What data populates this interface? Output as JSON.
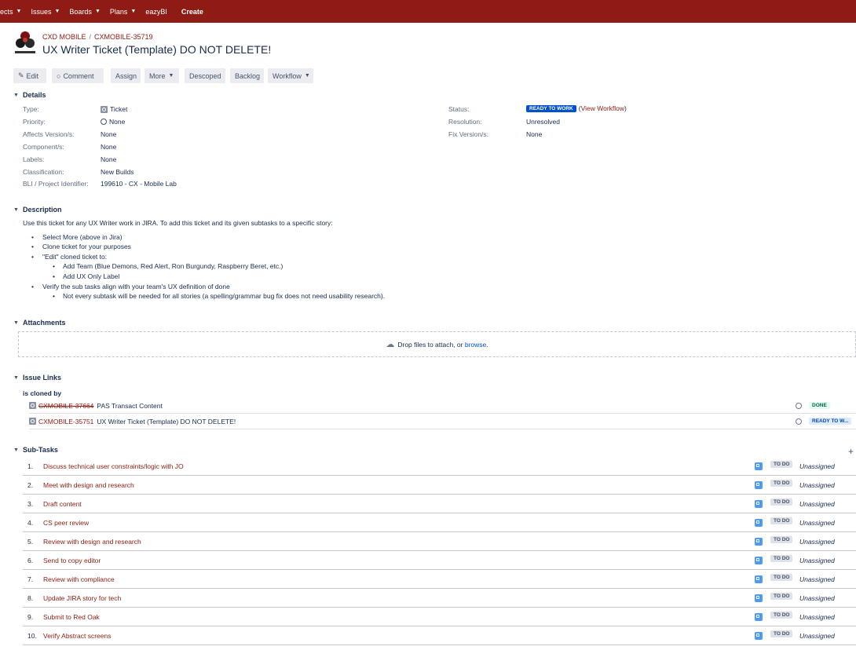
{
  "nav": {
    "items": [
      {
        "label": "ects",
        "chevron": true
      },
      {
        "label": "Issues",
        "chevron": true
      },
      {
        "label": "Boards",
        "chevron": true
      },
      {
        "label": "Plans",
        "chevron": true
      },
      {
        "label": "eazyBI",
        "chevron": false
      }
    ],
    "create_label": "Create"
  },
  "header": {
    "project": "CXD MOBILE",
    "separator": "/",
    "issue_key": "CXMOBILE-35719",
    "title": "UX Writer Ticket (Template) DO NOT DELETE!"
  },
  "toolbar": {
    "edit": "Edit",
    "comment": "Comment",
    "assign": "Assign",
    "more": "More",
    "descoped": "Descoped",
    "backlog": "Backlog",
    "workflow": "Workflow"
  },
  "details": {
    "heading": "Details",
    "type_label": "Type:",
    "type_value": "Ticket",
    "priority_label": "Priority:",
    "priority_value": "None",
    "affects_label": "Affects Version/s:",
    "affects_value": "None",
    "component_label": "Component/s:",
    "component_value": "None",
    "labels_label": "Labels:",
    "labels_value": "None",
    "classification_label": "Classification:",
    "classification_value": "New Builds",
    "bli_label": "BLI / Project Identifier:",
    "bli_value": "199610 - CX - Mobile Lab",
    "status_label": "Status:",
    "status_value": "READY TO WORK",
    "status_color": "#0052cc",
    "view_workflow_open": "(",
    "view_workflow": "View Workflow",
    "view_workflow_close": ")",
    "resolution_label": "Resolution:",
    "resolution_value": "Unresolved",
    "fix_label": "Fix Version/s:",
    "fix_value": "None"
  },
  "description": {
    "heading": "Description",
    "intro": "Use this ticket for any UX Writer work in JIRA. To add this ticket and its given subtasks to a specific story:",
    "items": [
      "Select More (above in Jira)",
      "Clone ticket for your purposes",
      "\"Edit\" cloned ticket to:",
      "Add Team (Blue Demons, Red Alert, Ron Burgundy, Raspberry Beret, etc.)",
      "Add UX Only Label",
      "Verify the sub tasks align with your team's UX definition of done",
      "Not every subtask will be needed for all stories (a spelling/grammar bug fix does not need usability research)."
    ]
  },
  "attachments": {
    "heading": "Attachments",
    "drop_text": "Drop files to attach, or ",
    "browse": "browse",
    "period": "."
  },
  "issue_links": {
    "heading": "Issue Links",
    "relation": "is cloned by",
    "links": [
      {
        "key": "CXMOBILE-37664",
        "summary": "PAS Transact Content",
        "status": "DONE"
      },
      {
        "key": "CXMOBILE-35751",
        "summary": "UX Writer Ticket (Template) DO NOT DELETE!",
        "status": "READY TO W..."
      }
    ]
  },
  "subtasks": {
    "heading": "Sub-Tasks",
    "add": "+",
    "items": [
      {
        "num": "1.",
        "name": "Discuss technical user constraints/logic with JO",
        "status": "TO DO",
        "assignee": "Unassigned"
      },
      {
        "num": "2.",
        "name": "Meet with design and research",
        "status": "TO DO",
        "assignee": "Unassigned"
      },
      {
        "num": "3.",
        "name": "Draft content",
        "status": "TO DO",
        "assignee": "Unassigned"
      },
      {
        "num": "4.",
        "name": "CS peer review",
        "status": "TO DO",
        "assignee": "Unassigned"
      },
      {
        "num": "5.",
        "name": "Review with design and research",
        "status": "TO DO",
        "assignee": "Unassigned"
      },
      {
        "num": "6.",
        "name": "Send to copy editor",
        "status": "TO DO",
        "assignee": "Unassigned"
      },
      {
        "num": "7.",
        "name": "Review with compliance",
        "status": "TO DO",
        "assignee": "Unassigned"
      },
      {
        "num": "8.",
        "name": "Update JIRA story for tech",
        "status": "TO DO",
        "assignee": "Unassigned"
      },
      {
        "num": "9.",
        "name": "Submit to Red Oak",
        "status": "TO DO",
        "assignee": "Unassigned"
      },
      {
        "num": "10.",
        "name": "Verify Abstract screens",
        "status": "TO DO",
        "assignee": "Unassigned"
      }
    ]
  },
  "colors": {
    "nav_bg": "#8e1b14",
    "link": "#8e1b14",
    "status_blue": "#0052cc"
  }
}
